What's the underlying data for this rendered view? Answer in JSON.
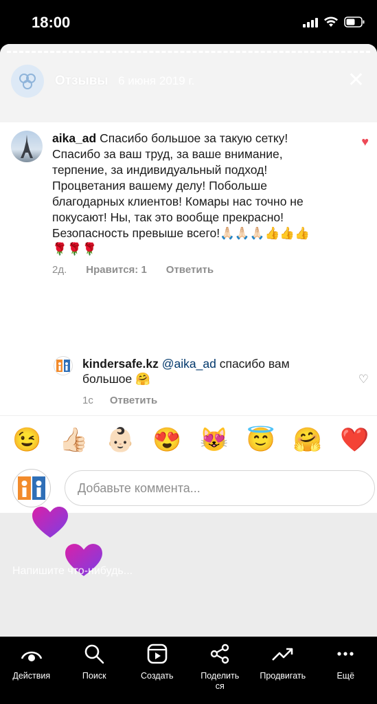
{
  "status_bar": {
    "time": "18:00"
  },
  "story": {
    "title": "Отзывы",
    "date": "6 июня 2019 г.",
    "close_symbol": "✕",
    "reply_placeholder": "Напишите что-нибудь..."
  },
  "comment": {
    "username": "aika_ad",
    "text": "Спасибо большое за такую сетку! Спасибо за ваш труд, за ваше внимание, терпение, за индивидуальный подход! Процветания вашему делу! Побольше благодарных клиентов! Комары нас точно не покусают! Ны, так это вообще прекрасно! Безопасность превыше всего!🙏🏻🙏🏻🙏🏻👍👍👍🌹🌹🌹",
    "time": "2д.",
    "likes": "Нравится: 1",
    "reply_label": "Ответить",
    "liked_icon": "♥"
  },
  "reply": {
    "username": "kindersafe.kz",
    "mention": "@aika_ad",
    "text": "спасибо вам большое 🤗",
    "time": "1с",
    "reply_label": "Ответить",
    "like_icon": "♡"
  },
  "emojis": [
    "😉",
    "👍🏻",
    "👶🏻",
    "😍",
    "😻",
    "😇",
    "🤗",
    "❤️"
  ],
  "comment_input": {
    "placeholder": "Добавьте коммента..."
  },
  "bottom_bar": [
    {
      "label": "Действия",
      "icon": "eye-icon"
    },
    {
      "label": "Поиск",
      "icon": "search-icon"
    },
    {
      "label": "Создать",
      "icon": "create-icon"
    },
    {
      "label": "Поделить\nся",
      "icon": "share-icon"
    },
    {
      "label": "Продвигать",
      "icon": "promote-icon"
    },
    {
      "label": "Ещё",
      "icon": "more-icon"
    }
  ],
  "colors": {
    "like_red": "#ed4956",
    "heart_gradient_from": "#d920a8",
    "heart_gradient_to": "#7b3fe4"
  }
}
